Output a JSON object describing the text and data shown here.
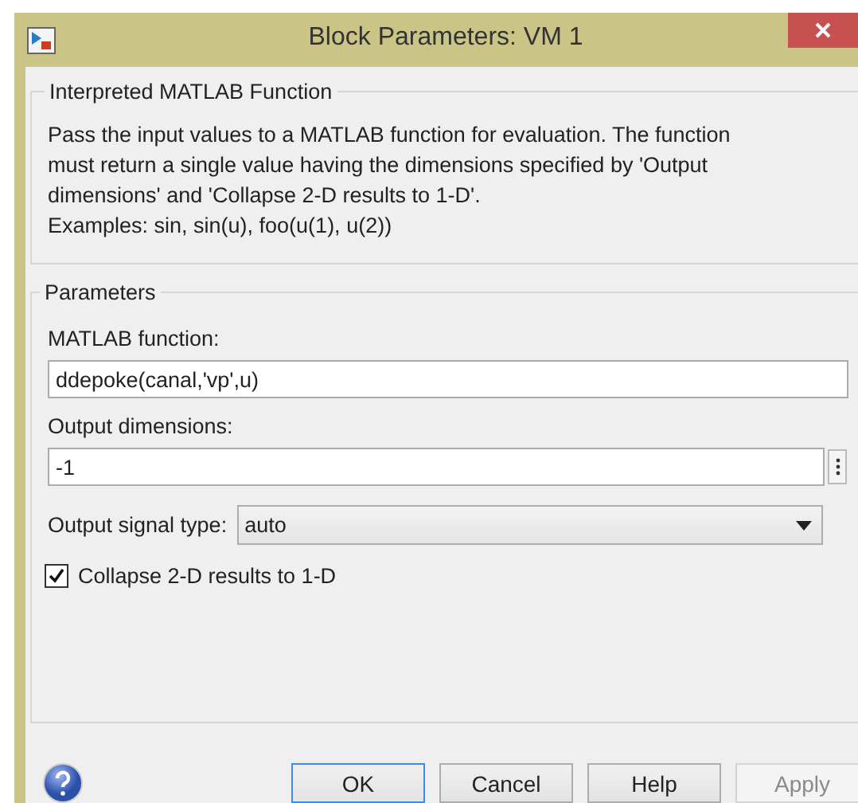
{
  "window": {
    "title": "Block Parameters: VM 1"
  },
  "description_group": {
    "title": "Interpreted MATLAB Function",
    "lines": [
      "Pass the input values to a MATLAB function for evaluation.  The function",
      "must return a single value having the dimensions specified by 'Output",
      "dimensions' and 'Collapse 2-D results to 1-D'.",
      "Examples: sin, sin(u), foo(u(1), u(2))"
    ]
  },
  "parameters_group": {
    "title": "Parameters",
    "fields": [
      {
        "kind": "text",
        "label": "MATLAB function:",
        "value": "ddepoke(canal,'vp',u)"
      },
      {
        "kind": "text_more",
        "label": "Output dimensions:",
        "value": "-1"
      },
      {
        "kind": "select",
        "label": "Output signal type:",
        "value": "auto"
      },
      {
        "kind": "checkbox",
        "label": "Collapse 2-D results to 1-D",
        "checked": true
      }
    ]
  },
  "buttons": [
    {
      "label": "OK",
      "focused": true,
      "disabled": false
    },
    {
      "label": "Cancel",
      "focused": false,
      "disabled": false
    },
    {
      "label": "Help",
      "focused": false,
      "disabled": false
    },
    {
      "label": "Apply",
      "focused": false,
      "disabled": true
    }
  ]
}
